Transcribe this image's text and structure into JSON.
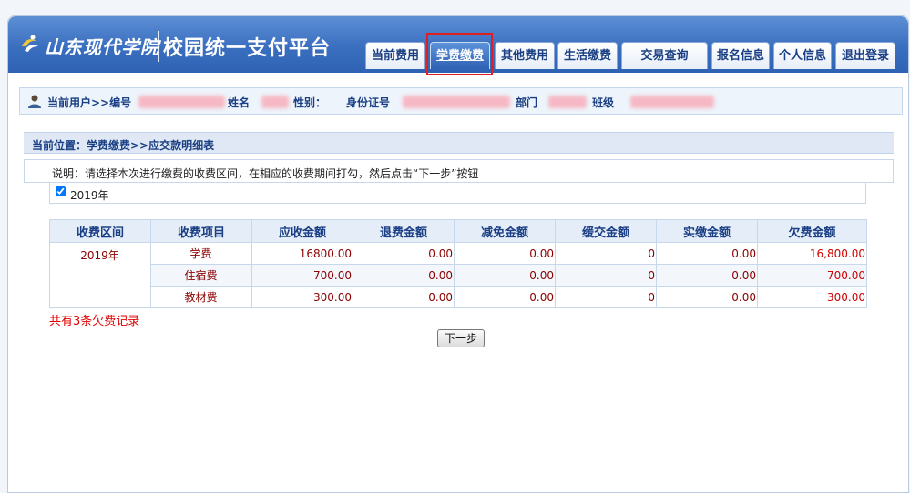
{
  "header": {
    "logo_text": "山东现代学院",
    "title": "校园统一支付平台"
  },
  "nav": {
    "items": [
      {
        "label": "当前费用"
      },
      {
        "label": "学费缴费"
      },
      {
        "label": "其他费用"
      },
      {
        "label": "生活缴费"
      },
      {
        "label": "交易查询"
      },
      {
        "label": "报名信息"
      },
      {
        "label": "个人信息"
      },
      {
        "label": "退出登录"
      }
    ],
    "active": "学费缴费"
  },
  "user_bar": {
    "current_user": "当前用户>>编号",
    "name_label": "姓名",
    "gender_label": "性别：",
    "id_label": "身份证号",
    "dept_label": "部门",
    "class_label": "班级"
  },
  "breadcrumb": "当前位置：学费缴费>>应交款明细表",
  "notice": "说明：请选择本次进行缴费的收费区间，在相应的收费期间打勾，然后点击“下一步”按钮",
  "period_option": {
    "label": "2019年",
    "checked": true
  },
  "table": {
    "headers": [
      "收费区间",
      "收费项目",
      "应收金额",
      "退费金额",
      "减免金额",
      "缓交金额",
      "实缴金额",
      "欠费金额"
    ],
    "period": "2019年",
    "rows": [
      {
        "item": "学费",
        "receivable": "16800.00",
        "refund": "0.00",
        "reduction": "0.00",
        "deferred": "0",
        "paid": "0.00",
        "owed": "16,800.00"
      },
      {
        "item": "住宿费",
        "receivable": "700.00",
        "refund": "0.00",
        "reduction": "0.00",
        "deferred": "0",
        "paid": "0.00",
        "owed": "700.00"
      },
      {
        "item": "教材费",
        "receivable": "300.00",
        "refund": "0.00",
        "reduction": "0.00",
        "deferred": "0",
        "paid": "0.00",
        "owed": "300.00"
      }
    ]
  },
  "summary": "共有3条欠费记录",
  "next_button": "下一步",
  "colors": {
    "header_blue": "#3a6fc0",
    "highlight": "#e02020",
    "owe_red": "#d00000"
  }
}
